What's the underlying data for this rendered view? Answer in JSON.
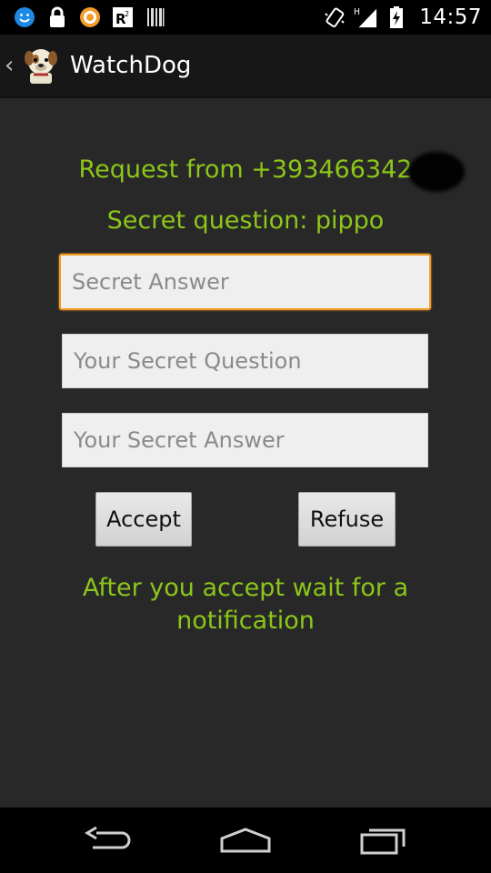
{
  "status_bar": {
    "time": "14:57",
    "left_icons": [
      "smiley-notification-icon",
      "lock-icon",
      "orange-ring-icon",
      "r2-icon",
      "barcode-icon"
    ],
    "right_icons": [
      "vibrate-icon",
      "signal-h-icon",
      "battery-charging-icon"
    ],
    "signal_type": "H"
  },
  "action_bar": {
    "title": "WatchDog"
  },
  "main": {
    "request_text": "Request from +393466342",
    "question_text": "Secret question: pippo",
    "fields": {
      "secret_answer_placeholder": "Secret Answer",
      "your_question_placeholder": "Your Secret Question",
      "your_answer_placeholder": "Your Secret Answer"
    },
    "accept_label": "Accept",
    "refuse_label": "Refuse",
    "note": "After you accept wait for a notification"
  },
  "colors": {
    "accent_text": "#8cc61a",
    "focus_border": "#f49b26",
    "background": "#282828"
  }
}
